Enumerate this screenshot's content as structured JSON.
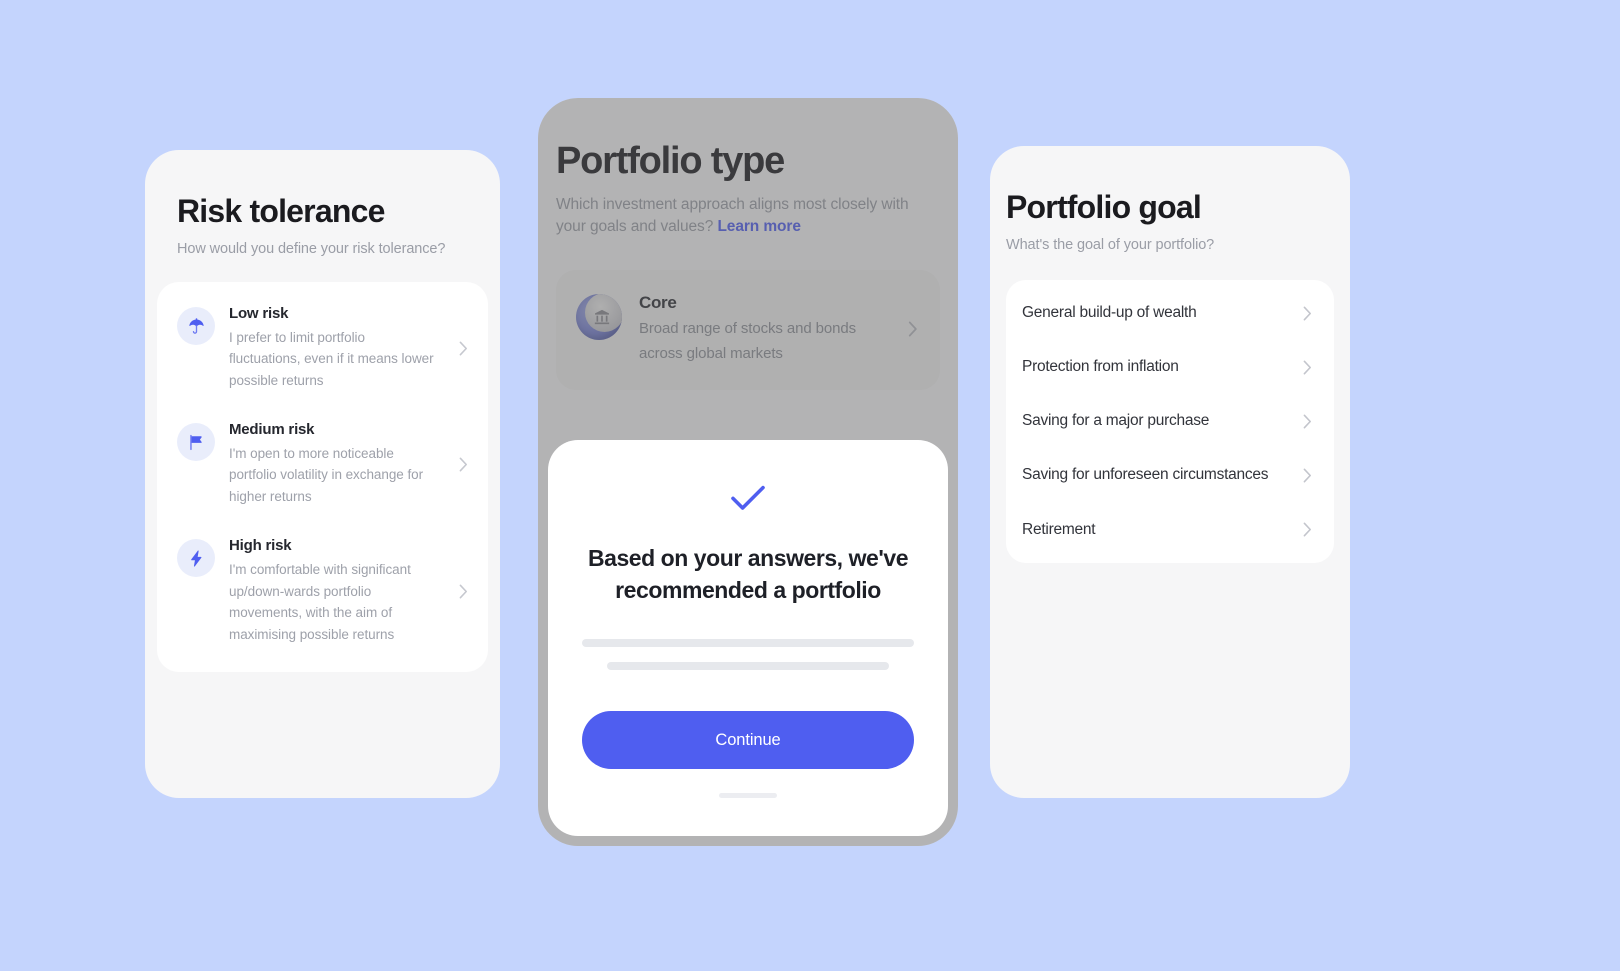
{
  "theme": {
    "background": "#c4d4fd",
    "card_background": "#f6f6f7",
    "list_background": "#ffffff",
    "accent": "#4f5ef0",
    "muted_text": "#9a9da6",
    "title_text": "#1b1b1f",
    "skeleton": "#e6e8ec",
    "dim_overlay": "rgba(98,98,98,0.45)"
  },
  "risk_screen": {
    "title": "Risk tolerance",
    "subtitle": "How would you define your risk tolerance?",
    "options": [
      {
        "icon": "umbrella-icon",
        "title": "Low risk",
        "description": "I prefer to limit portfolio fluctuations, even if it means lower possible returns",
        "chevron": "chevron-right-icon"
      },
      {
        "icon": "flag-icon",
        "title": "Medium risk",
        "description": "I'm open to more noticeable portfolio volatility in exchange for higher returns",
        "chevron": "chevron-right-icon"
      },
      {
        "icon": "lightning-bolt-icon",
        "title": "High risk",
        "description": "I'm comfortable with significant up/down-wards portfolio movements, with the aim of maximising possible returns",
        "chevron": "chevron-right-icon"
      }
    ]
  },
  "type_screen": {
    "title": "Portfolio type",
    "subtitle_text": "Which investment approach aligns most closely with your goals and values?",
    "subtitle_link": "Learn more",
    "option": {
      "icon": "bank-coin-icon",
      "title": "Core",
      "description": "Broad range of stocks and bonds across global markets",
      "chevron": "chevron-right-icon"
    },
    "modal": {
      "icon": "check-icon",
      "title": "Based on your answers, we've recommended a portfolio",
      "skeleton_lines": 2,
      "continue_label": "Continue",
      "home_indicator": "home-indicator"
    }
  },
  "goal_screen": {
    "title": "Portfolio goal",
    "subtitle": "What's the goal of your portfolio?",
    "options": [
      {
        "label": "General build-up of wealth",
        "chevron": "chevron-right-icon"
      },
      {
        "label": "Protection from inflation",
        "chevron": "chevron-right-icon"
      },
      {
        "label": "Saving for a major purchase",
        "chevron": "chevron-right-icon"
      },
      {
        "label": "Saving for unforeseen circumstances",
        "chevron": "chevron-right-icon"
      },
      {
        "label": "Retirement",
        "chevron": "chevron-right-icon"
      }
    ]
  }
}
